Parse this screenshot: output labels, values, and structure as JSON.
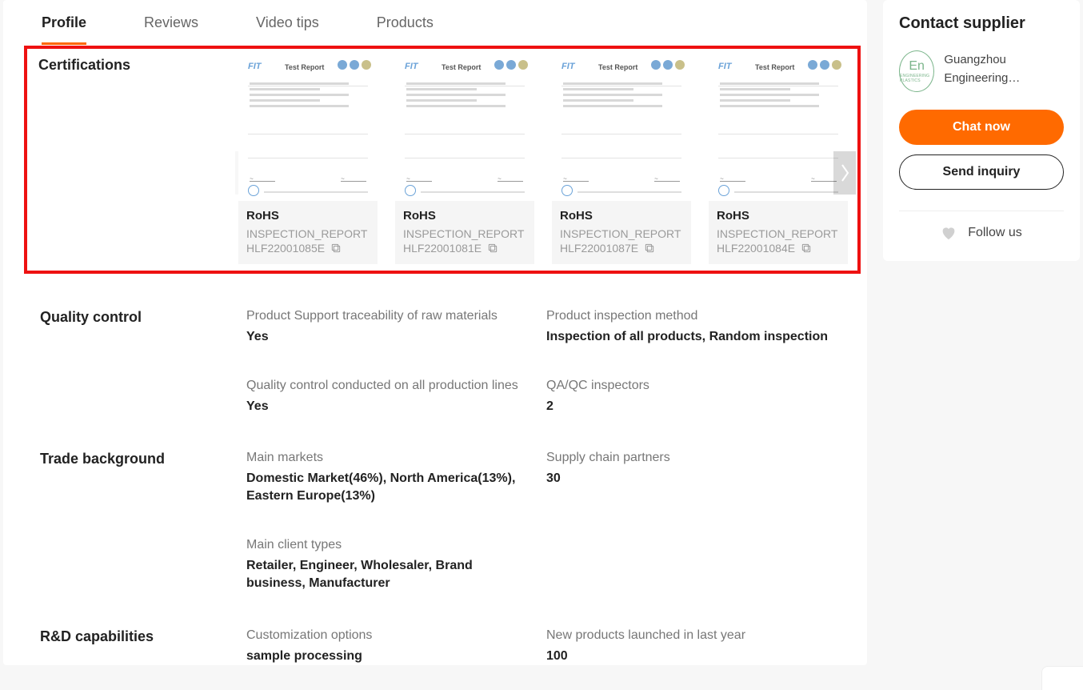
{
  "tabs": [
    "Profile",
    "Reviews",
    "Video tips",
    "Products"
  ],
  "active_tab": 0,
  "certifications": {
    "label": "Certifications",
    "items": [
      {
        "title": "RoHS",
        "sub1": "INSPECTION_REPORT",
        "sub2": "HLF22001085E"
      },
      {
        "title": "RoHS",
        "sub1": "INSPECTION_REPORT",
        "sub2": "HLF22001081E"
      },
      {
        "title": "RoHS",
        "sub1": "INSPECTION_REPORT",
        "sub2": "HLF22001087E"
      },
      {
        "title": "RoHS",
        "sub1": "INSPECTION_REPORT",
        "sub2": "HLF22001084E"
      }
    ],
    "doc_header": "Test Report",
    "doc_brand": "FIT"
  },
  "quality_control": {
    "label": "Quality control",
    "traceability": {
      "k": "Product Support traceability of raw materials",
      "v": "Yes"
    },
    "inspection_method": {
      "k": "Product inspection method",
      "v": "Inspection of all products, Random inspection"
    },
    "qc_all_lines": {
      "k": "Quality control conducted on all production lines",
      "v": "Yes"
    },
    "inspectors": {
      "k": "QA/QC inspectors",
      "v": "2"
    }
  },
  "trade_background": {
    "label": "Trade background",
    "main_markets": {
      "k": "Main markets",
      "v": "Domestic Market(46%), North America(13%), Eastern Europe(13%)"
    },
    "supply_chain": {
      "k": "Supply chain partners",
      "v": "30"
    },
    "client_types": {
      "k": "Main client types",
      "v": "Retailer, Engineer, Wholesaler, Brand business, Manufacturer"
    }
  },
  "rd": {
    "label": "R&D capabilities",
    "customization": {
      "k": "Customization options",
      "v": "sample processing"
    },
    "new_products": {
      "k": "New products launched in last year",
      "v": "100"
    }
  },
  "sidebar": {
    "title": "Contact supplier",
    "supplier_name": "Guangzhou Engineering…",
    "logo_text": "En",
    "logo_sub": "ENGINEERING PLASTICS",
    "chat": "Chat now",
    "inquiry": "Send inquiry",
    "follow": "Follow us"
  }
}
